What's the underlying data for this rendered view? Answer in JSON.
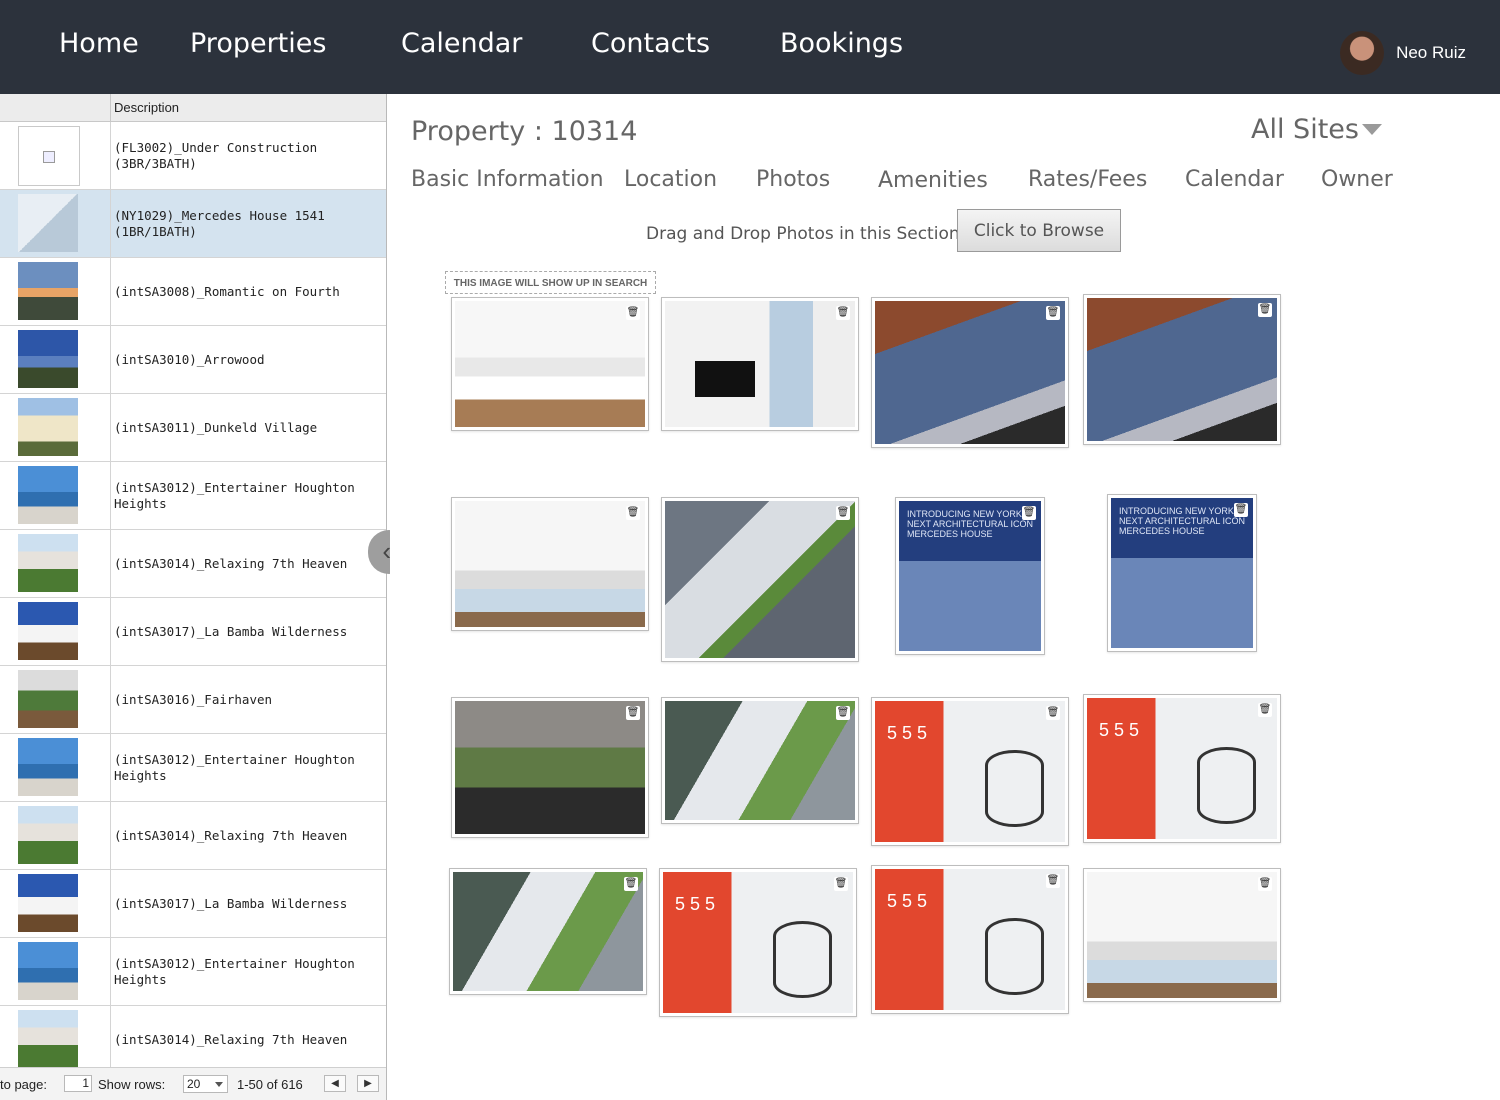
{
  "nav": {
    "items": [
      "Home",
      "Properties",
      "Calendar",
      "Contacts",
      "Bookings"
    ],
    "user_name": "Neo Ruiz"
  },
  "property_list": {
    "column_header": "Description",
    "rows": [
      {
        "description": "(FL3002)_Under Construction (3BR/3BATH)",
        "thumbnail": "broken-image"
      },
      {
        "description": "(NY1029)_Mercedes House 1541 (1BR/1BATH)",
        "thumbnail": "interior",
        "selected": true
      },
      {
        "description": "(intSA3008)_Romantic on Fourth",
        "thumbnail": "sunset-coast"
      },
      {
        "description": "(intSA3010)_Arrowood",
        "thumbnail": "bay-view"
      },
      {
        "description": "(intSA3011)_Dunkeld Village",
        "thumbnail": "house"
      },
      {
        "description": "(intSA3012)_Entertainer Houghton Heights",
        "thumbnail": "pool-deck"
      },
      {
        "description": "(intSA3014)_Relaxing 7th Heaven",
        "thumbnail": "apartment-building"
      },
      {
        "description": "(intSA3017)_La Bamba Wilderness",
        "thumbnail": "white-house"
      },
      {
        "description": "(intSA3016)_Fairhaven",
        "thumbnail": "garden-house"
      },
      {
        "description": "(intSA3012)_Entertainer Houghton Heights",
        "thumbnail": "pool-deck"
      },
      {
        "description": "(intSA3014)_Relaxing 7th Heaven",
        "thumbnail": "apartment-building"
      },
      {
        "description": "(intSA3017)_La Bamba Wilderness",
        "thumbnail": "white-house"
      },
      {
        "description": "(intSA3012)_Entertainer Houghton Heights",
        "thumbnail": "pool-deck"
      },
      {
        "description": "(intSA3014)_Relaxing 7th Heaven",
        "thumbnail": "apartment-building"
      }
    ],
    "footer": {
      "goto_label": "to page:",
      "page_value": "1",
      "show_rows_label": "Show rows:",
      "rows_value": "20",
      "range": "1-50 of 616"
    }
  },
  "main": {
    "title": "Property : 10314",
    "site_select": "All Sites",
    "tabs": [
      "Basic Information",
      "Location",
      "Photos",
      "Amenities",
      "Rates/Fees",
      "Calendar",
      "Owner"
    ],
    "drop_text": "Drag and Drop Photos in this Section or",
    "browse_button": "Click to Browse",
    "search_label": "THIS IMAGE WILL SHOW UP IN SEARCH",
    "ad_text": "INTRODUCING NEW YORK'S NEXT ARCHITECTURAL ICON MERCEDES HOUSE",
    "lobby_number": "5 5 5",
    "photo_count": 16
  },
  "colors": {
    "nav_bg": "#2c323c",
    "selected_row": "#d4e3ef",
    "muted_text": "#666666"
  }
}
